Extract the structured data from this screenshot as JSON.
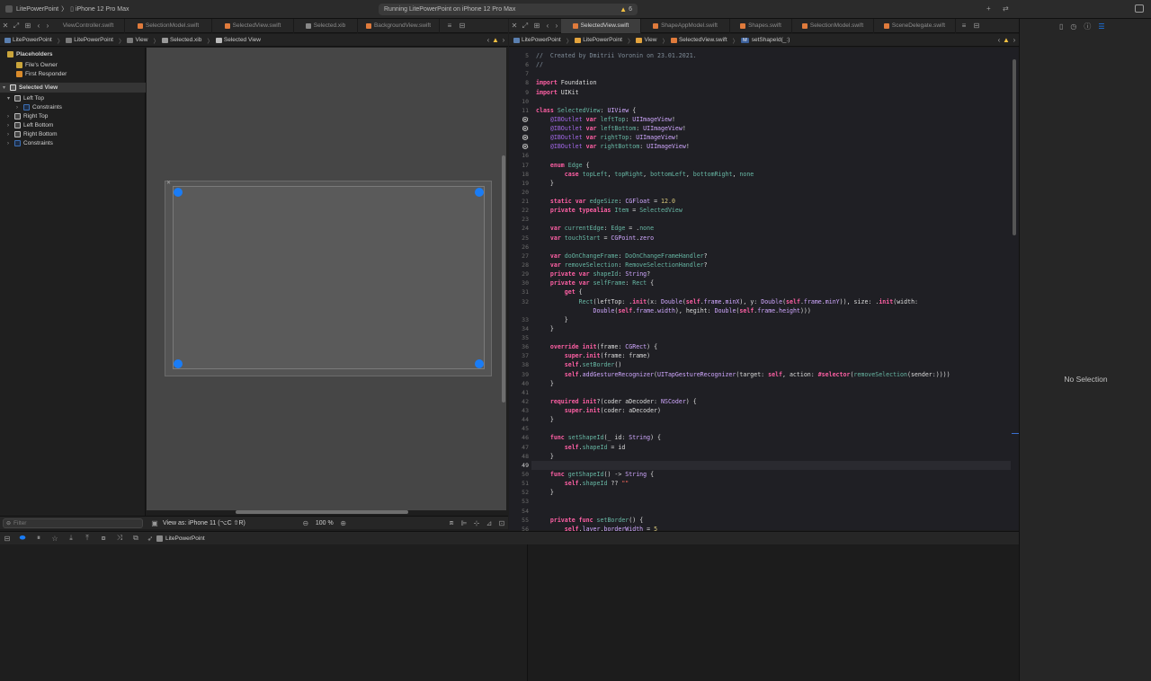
{
  "titlebar": {
    "scheme": "LitePowerPoint",
    "device": "iPhone 12 Pro Max",
    "status": "Running LitePowerPoint on iPhone 12 Pro Max",
    "warning_count": "6"
  },
  "left_tabs": [
    "ViewController.swift",
    "SelectionModel.swift",
    "SelectedView.swift",
    "Selected.xib",
    "BackgroundView.swift"
  ],
  "left_active_tab": "Selected.xib",
  "right_tabs": [
    "SelectedView.swift",
    "ShapeAppModel.swift",
    "Shapes.swift",
    "SelectionModel.swift",
    "SceneDelegate.swift"
  ],
  "right_active_tab": "SelectedView.swift",
  "left_jumpbar": [
    "LitePowerPoint",
    "LitePowerPoint",
    "View",
    "Selected.xib",
    "Selected View"
  ],
  "right_jumpbar": [
    "LitePowerPoint",
    "LitePowerPoint",
    "View",
    "SelectedView.swift",
    "setShapeId(_:)"
  ],
  "right_jumpbar_badge": "M",
  "outline": {
    "placeholders_label": "Placeholders",
    "files_owner": "File's Owner",
    "first_responder": "First Responder",
    "selected_view": "Selected View",
    "left_top": "Left Top",
    "constraints_child": "Constraints",
    "right_top": "Right Top",
    "left_bottom": "Left Bottom",
    "right_bottom": "Right Bottom",
    "constraints": "Constraints",
    "filter_placeholder": "Filter"
  },
  "canvas_bar": {
    "view_as": "View as: iPhone 11 (⁠ ⁠C ⁠ ⁠R)",
    "view_as_text": "View as: iPhone 11 (⌥C ⇧R)",
    "zoom": "100 %"
  },
  "debug_bar": {
    "target": "LitePowerPoint"
  },
  "inspector": {
    "empty_label": "No Selection"
  },
  "code": {
    "lines": [
      {
        "n": "5",
        "html": "<span class='cm'>//  Created by Dmitrii Voronin on 23.01.2021.</span>"
      },
      {
        "n": "6",
        "html": "<span class='cm'>//</span>"
      },
      {
        "n": "7",
        "html": ""
      },
      {
        "n": "8",
        "html": "<span class='kw'>import</span> Foundation"
      },
      {
        "n": "9",
        "html": "<span class='kw'>import</span> UIKit"
      },
      {
        "n": "10",
        "html": ""
      },
      {
        "n": "11",
        "html": "<span class='kw'>class</span> <span class='pr'>SelectedView</span>: <span class='ty'>UIView</span> {"
      },
      {
        "n": "12",
        "html": "    <span class='pt'>@IBOutlet</span> <span class='kw'>var</span> <span class='pr'>leftTop</span>: <span class='ty'>UIImageView</span>!",
        "bp": true
      },
      {
        "n": "13",
        "html": "    <span class='pt'>@IBOutlet</span> <span class='kw'>var</span> <span class='pr'>leftBottom</span>: <span class='ty'>UIImageView</span>!",
        "bp": true
      },
      {
        "n": "14",
        "html": "    <span class='pt'>@IBOutlet</span> <span class='kw'>var</span> <span class='pr'>rightTop</span>: <span class='ty'>UIImageView</span>!",
        "bp": true
      },
      {
        "n": "15",
        "html": "    <span class='pt'>@IBOutlet</span> <span class='kw'>var</span> <span class='pr'>rightBottom</span>: <span class='ty'>UIImageView</span>!",
        "bp": true
      },
      {
        "n": "16",
        "html": ""
      },
      {
        "n": "17",
        "html": "    <span class='kw'>enum</span> <span class='pr'>Edge</span> {"
      },
      {
        "n": "18",
        "html": "        <span class='kw'>case</span> <span class='pr'>topLeft</span>, <span class='pr'>topRight</span>, <span class='pr'>bottomLeft</span>, <span class='pr'>bottomRight</span>, <span class='pr'>none</span>"
      },
      {
        "n": "19",
        "html": "    }"
      },
      {
        "n": "20",
        "html": ""
      },
      {
        "n": "21",
        "html": "    <span class='kw'>static</span> <span class='kw'>var</span> <span class='pr'>edgeSize</span>: <span class='ty'>CGFloat</span> = <span class='nu'>12.0</span>"
      },
      {
        "n": "22",
        "html": "    <span class='kw'>private</span> <span class='kw'>typealias</span> <span class='pr'>Item</span> = <span class='pr'>SelectedView</span>"
      },
      {
        "n": "23",
        "html": ""
      },
      {
        "n": "24",
        "html": "    <span class='kw'>var</span> <span class='pr'>currentEdge</span>: <span class='pr'>Edge</span> = .<span class='pr'>none</span>"
      },
      {
        "n": "25",
        "html": "    <span class='kw'>var</span> <span class='pr'>touchStart</span> = <span class='ty'>CGPoint</span>.<span class='ty'>zero</span>"
      },
      {
        "n": "26",
        "html": ""
      },
      {
        "n": "27",
        "html": "    <span class='kw'>var</span> <span class='pr'>doOnChangeFrame</span>: <span class='pr'>DoOnChangeFrameHandler</span>?"
      },
      {
        "n": "28",
        "html": "    <span class='kw'>var</span> <span class='pr'>removeSelection</span>: <span class='pr'>RemoveSelectionHandler</span>?"
      },
      {
        "n": "29",
        "html": "    <span class='kw'>private</span> <span class='kw'>var</span> <span class='pr'>shapeId</span>: <span class='ty'>String</span>?"
      },
      {
        "n": "30",
        "html": "    <span class='kw'>private</span> <span class='kw'>var</span> <span class='pr'>selfFrame</span>: <span class='pr'>Rect</span> {"
      },
      {
        "n": "31",
        "html": "        <span class='kw'>get</span> {"
      },
      {
        "n": "32",
        "html": "            <span class='pr'>Rect</span>(leftTop: .<span class='kw'>init</span>(x: <span class='ty'>Double</span>(<span class='kw'>self</span>.<span class='ty'>frame</span>.<span class='ty'>minX</span>), y: <span class='ty'>Double</span>(<span class='kw'>self</span>.<span class='ty'>frame</span>.<span class='ty'>minY</span>)), size: .<span class='kw'>init</span>(width:"
      },
      {
        "n": "",
        "html": "                <span class='ty'>Double</span>(<span class='kw'>self</span>.<span class='ty'>frame</span>.<span class='ty'>width</span>), hegiht: <span class='ty'>Double</span>(<span class='kw'>self</span>.<span class='ty'>frame</span>.<span class='ty'>height</span>)))"
      },
      {
        "n": "33",
        "html": "        }"
      },
      {
        "n": "34",
        "html": "    }"
      },
      {
        "n": "35",
        "html": ""
      },
      {
        "n": "36",
        "html": "    <span class='kw'>override</span> <span class='kw'>init</span>(frame: <span class='ty'>CGRect</span>) {"
      },
      {
        "n": "37",
        "html": "        <span class='kw'>super</span>.<span class='kw'>init</span>(frame: frame)"
      },
      {
        "n": "38",
        "html": "        <span class='kw'>self</span>.<span class='pr'>setBorder</span>()"
      },
      {
        "n": "39",
        "html": "        <span class='kw'>self</span>.<span class='ty'>addGestureRecognizer</span>(<span class='ty'>UITapGestureRecognizer</span>(target: <span class='kw'>self</span>, action: <span class='kw'>#selector</span>(<span class='pr'>removeSelection</span>(sender:))))"
      },
      {
        "n": "40",
        "html": "    }"
      },
      {
        "n": "41",
        "html": ""
      },
      {
        "n": "42",
        "html": "    <span class='kw'>required</span> <span class='kw'>init</span>?(coder aDecoder: <span class='ty'>NSCoder</span>) {"
      },
      {
        "n": "43",
        "html": "        <span class='kw'>super</span>.<span class='kw'>init</span>(coder: aDecoder)"
      },
      {
        "n": "44",
        "html": "    }"
      },
      {
        "n": "45",
        "html": ""
      },
      {
        "n": "46",
        "html": "    <span class='kw'>func</span> <span class='fn'>setShapeId</span>(_ id: <span class='ty'>String</span>) {"
      },
      {
        "n": "47",
        "html": "        <span class='kw'>self</span>.<span class='pr'>shapeId</span> = id"
      },
      {
        "n": "48",
        "html": "    }"
      },
      {
        "n": "49",
        "html": "",
        "cur": true
      },
      {
        "n": "50",
        "html": "    <span class='kw'>func</span> <span class='fn'>getShapeId</span>() -&gt; <span class='ty'>String</span> {"
      },
      {
        "n": "51",
        "html": "        <span class='kw'>self</span>.<span class='pr'>shapeId</span> ?? <span class='st'>\"\"</span>"
      },
      {
        "n": "52",
        "html": "    }"
      },
      {
        "n": "53",
        "html": ""
      },
      {
        "n": "54",
        "html": ""
      },
      {
        "n": "55",
        "html": "    <span class='kw'>private</span> <span class='kw'>func</span> <span class='fn'>setBorder</span>() {"
      },
      {
        "n": "56",
        "html": "        <span class='kw'>self</span>.<span class='ty'>layer</span>.<span class='ty'>borderWidth</span> = <span class='nu'>5</span>"
      }
    ]
  },
  "colors": {
    "accent": "#1a7cf5",
    "warning": "#f5c242",
    "swift_file": "#e07b3c"
  }
}
